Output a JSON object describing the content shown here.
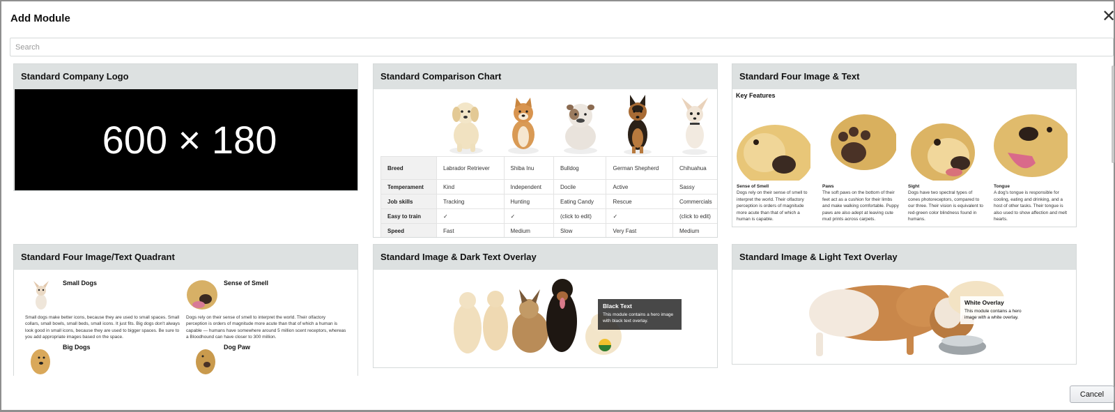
{
  "dialog": {
    "title": "Add Module",
    "close_glyph": "✕",
    "search_placeholder": "Search",
    "cancel_label": "Cancel"
  },
  "modules": {
    "company_logo": {
      "title": "Standard Company Logo",
      "placeholder_text": "600 × 180"
    },
    "comparison_chart": {
      "title": "Standard Comparison Chart",
      "rows": [
        {
          "label": "Breed",
          "cells": [
            "Labrador Retriever",
            "Shiba Inu",
            "Bulldog",
            "German Shepherd",
            "Chihuahua"
          ]
        },
        {
          "label": "Temperament",
          "cells": [
            "Kind",
            "Independent",
            "Docile",
            "Active",
            "Sassy"
          ]
        },
        {
          "label": "Job skills",
          "cells": [
            "Tracking",
            "Hunting",
            "Eating Candy",
            "Rescue",
            "Commercials"
          ]
        },
        {
          "label": "Easy to train",
          "cells": [
            "✓",
            "✓",
            "(click to edit)",
            "✓",
            "(click to edit)"
          ]
        },
        {
          "label": "Speed",
          "cells": [
            "Fast",
            "Medium",
            "Slow",
            "Very Fast",
            "Medium"
          ]
        }
      ]
    },
    "four_image_text": {
      "title": "Standard Four Image & Text",
      "heading": "Key Features",
      "items": [
        {
          "title": "Sense of Smell",
          "text": "Dogs rely on their sense of smell to interpret the world. Their olfactory perception is orders of magnitude more acute than that of which a human is capable."
        },
        {
          "title": "Paws",
          "text": "The soft paws on the bottom of their feet act as a cushion for their limbs and make walking comfortable. Puppy paws are also adept at leaving cute mud prints across carpets."
        },
        {
          "title": "Sight",
          "text": "Dogs have two spectral types of cones photoreceptors, compared to our three. Their vision is equivalent to red-green color blindness found in humans."
        },
        {
          "title": "Tongue",
          "text": "A dog's tongue is responsible for cooling, eating and drinking, and a host of other tasks. Their tongue is also used to show affection and melt hearts."
        }
      ]
    },
    "quadrant": {
      "title": "Standard Four Image/Text Quadrant",
      "items": [
        {
          "title": "Small Dogs",
          "text": "Small dogs make better icons, because they are used to small spaces. Small collars, small bowls, small beds, small icons. It just fits. Big dogs don't always look good in small icons, because they are used to bigger spaces. Be sure to you add appropriate images based on the space."
        },
        {
          "title": "Sense of Smell",
          "text": "Dogs rely on their sense of smell to interpret the world. Their olfactory perception is orders of magnitude more acute than that of which a human is capable — humans have somewhere around 5 million scent receptors, whereas a Bloodhound can have closer to 300 million."
        },
        {
          "title": "Big Dogs",
          "text": ""
        },
        {
          "title": "Dog Paw",
          "text": ""
        }
      ]
    },
    "dark_overlay": {
      "title": "Standard Image & Dark Text Overlay",
      "overlay_title": "Black Text",
      "overlay_text": "This module contains a hero image with black text overlay."
    },
    "light_overlay": {
      "title": "Standard Image & Light Text Overlay",
      "overlay_title": "White Overlay",
      "overlay_text": "This module contains a hero image with a white overlay."
    }
  }
}
